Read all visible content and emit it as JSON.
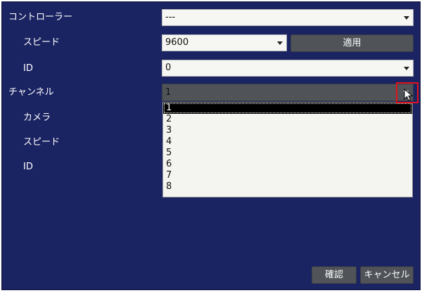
{
  "form": {
    "controller_label": "コントローラー",
    "controller_value": "---",
    "speed_label": "スピード",
    "speed_value": "9600",
    "apply_button": "適用",
    "id_label": "ID",
    "id_value": "0",
    "channel_label": "チャンネル",
    "channel_value": "1",
    "camera_label": "カメラ",
    "speed2_label": "スピード",
    "id2_label": "ID"
  },
  "dropdown": {
    "options": [
      "1",
      "2",
      "3",
      "4",
      "5",
      "6",
      "7",
      "8"
    ],
    "selected": "1"
  },
  "footer": {
    "confirm_button": "確認",
    "cancel_button": "キャンセル"
  },
  "colors": {
    "panel_bg": "#1b2462",
    "highlight": "#e0121b"
  }
}
